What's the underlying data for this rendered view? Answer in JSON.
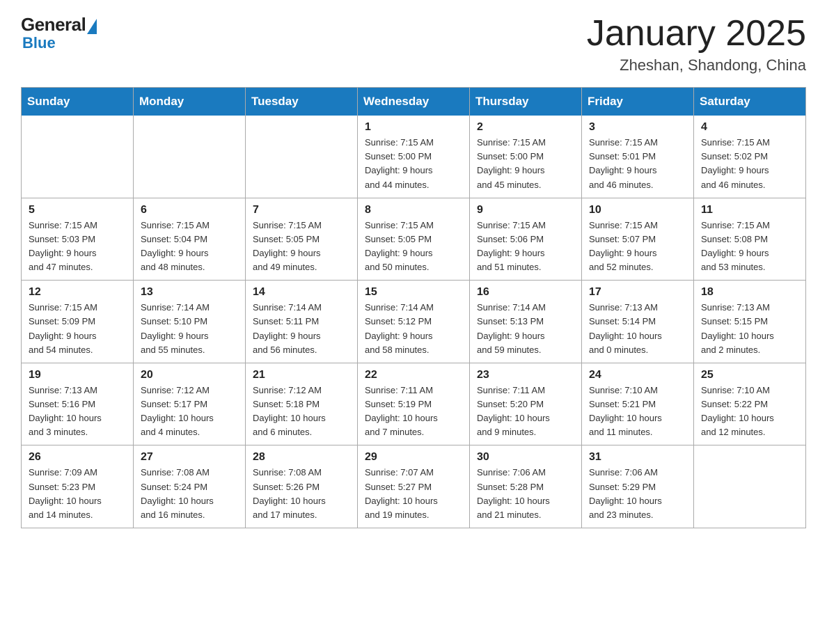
{
  "header": {
    "logo_general": "General",
    "logo_blue": "Blue",
    "month_title": "January 2025",
    "subtitle": "Zheshan, Shandong, China"
  },
  "days_of_week": [
    "Sunday",
    "Monday",
    "Tuesday",
    "Wednesday",
    "Thursday",
    "Friday",
    "Saturday"
  ],
  "weeks": [
    [
      {
        "day": "",
        "info": ""
      },
      {
        "day": "",
        "info": ""
      },
      {
        "day": "",
        "info": ""
      },
      {
        "day": "1",
        "info": "Sunrise: 7:15 AM\nSunset: 5:00 PM\nDaylight: 9 hours\nand 44 minutes."
      },
      {
        "day": "2",
        "info": "Sunrise: 7:15 AM\nSunset: 5:00 PM\nDaylight: 9 hours\nand 45 minutes."
      },
      {
        "day": "3",
        "info": "Sunrise: 7:15 AM\nSunset: 5:01 PM\nDaylight: 9 hours\nand 46 minutes."
      },
      {
        "day": "4",
        "info": "Sunrise: 7:15 AM\nSunset: 5:02 PM\nDaylight: 9 hours\nand 46 minutes."
      }
    ],
    [
      {
        "day": "5",
        "info": "Sunrise: 7:15 AM\nSunset: 5:03 PM\nDaylight: 9 hours\nand 47 minutes."
      },
      {
        "day": "6",
        "info": "Sunrise: 7:15 AM\nSunset: 5:04 PM\nDaylight: 9 hours\nand 48 minutes."
      },
      {
        "day": "7",
        "info": "Sunrise: 7:15 AM\nSunset: 5:05 PM\nDaylight: 9 hours\nand 49 minutes."
      },
      {
        "day": "8",
        "info": "Sunrise: 7:15 AM\nSunset: 5:05 PM\nDaylight: 9 hours\nand 50 minutes."
      },
      {
        "day": "9",
        "info": "Sunrise: 7:15 AM\nSunset: 5:06 PM\nDaylight: 9 hours\nand 51 minutes."
      },
      {
        "day": "10",
        "info": "Sunrise: 7:15 AM\nSunset: 5:07 PM\nDaylight: 9 hours\nand 52 minutes."
      },
      {
        "day": "11",
        "info": "Sunrise: 7:15 AM\nSunset: 5:08 PM\nDaylight: 9 hours\nand 53 minutes."
      }
    ],
    [
      {
        "day": "12",
        "info": "Sunrise: 7:15 AM\nSunset: 5:09 PM\nDaylight: 9 hours\nand 54 minutes."
      },
      {
        "day": "13",
        "info": "Sunrise: 7:14 AM\nSunset: 5:10 PM\nDaylight: 9 hours\nand 55 minutes."
      },
      {
        "day": "14",
        "info": "Sunrise: 7:14 AM\nSunset: 5:11 PM\nDaylight: 9 hours\nand 56 minutes."
      },
      {
        "day": "15",
        "info": "Sunrise: 7:14 AM\nSunset: 5:12 PM\nDaylight: 9 hours\nand 58 minutes."
      },
      {
        "day": "16",
        "info": "Sunrise: 7:14 AM\nSunset: 5:13 PM\nDaylight: 9 hours\nand 59 minutes."
      },
      {
        "day": "17",
        "info": "Sunrise: 7:13 AM\nSunset: 5:14 PM\nDaylight: 10 hours\nand 0 minutes."
      },
      {
        "day": "18",
        "info": "Sunrise: 7:13 AM\nSunset: 5:15 PM\nDaylight: 10 hours\nand 2 minutes."
      }
    ],
    [
      {
        "day": "19",
        "info": "Sunrise: 7:13 AM\nSunset: 5:16 PM\nDaylight: 10 hours\nand 3 minutes."
      },
      {
        "day": "20",
        "info": "Sunrise: 7:12 AM\nSunset: 5:17 PM\nDaylight: 10 hours\nand 4 minutes."
      },
      {
        "day": "21",
        "info": "Sunrise: 7:12 AM\nSunset: 5:18 PM\nDaylight: 10 hours\nand 6 minutes."
      },
      {
        "day": "22",
        "info": "Sunrise: 7:11 AM\nSunset: 5:19 PM\nDaylight: 10 hours\nand 7 minutes."
      },
      {
        "day": "23",
        "info": "Sunrise: 7:11 AM\nSunset: 5:20 PM\nDaylight: 10 hours\nand 9 minutes."
      },
      {
        "day": "24",
        "info": "Sunrise: 7:10 AM\nSunset: 5:21 PM\nDaylight: 10 hours\nand 11 minutes."
      },
      {
        "day": "25",
        "info": "Sunrise: 7:10 AM\nSunset: 5:22 PM\nDaylight: 10 hours\nand 12 minutes."
      }
    ],
    [
      {
        "day": "26",
        "info": "Sunrise: 7:09 AM\nSunset: 5:23 PM\nDaylight: 10 hours\nand 14 minutes."
      },
      {
        "day": "27",
        "info": "Sunrise: 7:08 AM\nSunset: 5:24 PM\nDaylight: 10 hours\nand 16 minutes."
      },
      {
        "day": "28",
        "info": "Sunrise: 7:08 AM\nSunset: 5:26 PM\nDaylight: 10 hours\nand 17 minutes."
      },
      {
        "day": "29",
        "info": "Sunrise: 7:07 AM\nSunset: 5:27 PM\nDaylight: 10 hours\nand 19 minutes."
      },
      {
        "day": "30",
        "info": "Sunrise: 7:06 AM\nSunset: 5:28 PM\nDaylight: 10 hours\nand 21 minutes."
      },
      {
        "day": "31",
        "info": "Sunrise: 7:06 AM\nSunset: 5:29 PM\nDaylight: 10 hours\nand 23 minutes."
      },
      {
        "day": "",
        "info": ""
      }
    ]
  ]
}
